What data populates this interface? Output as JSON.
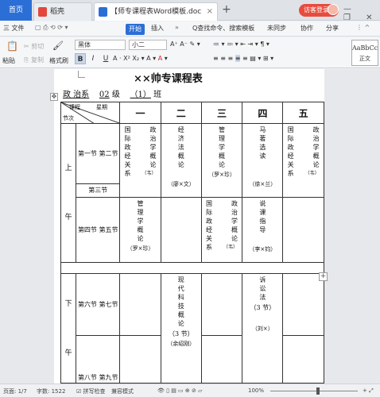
{
  "tabs": {
    "home": "首页",
    "daoke": "稻壳",
    "doc": "【师专课程表Word模板.doc",
    "login": "访客登录"
  },
  "menu": {
    "file": "三 文件",
    "start": "开始",
    "insert": "插入",
    "search": "Q查找命令、搜索模板",
    "unsync": "未同步",
    "collab": "协作",
    "share": "分享"
  },
  "ribbon": {
    "paste": "粘贴",
    "cut": "剪切",
    "copy": "复制",
    "format_painter": "格式刷",
    "font": "黑体",
    "size": "小二",
    "bold": "B",
    "italic": "I",
    "underline": "U",
    "style_sample": "AaBbCc",
    "style_name": "正文"
  },
  "doc": {
    "title": "××帅专课程表",
    "dept": "政 治系",
    "grade": "02",
    "grade_suffix": "级",
    "class": "（1）",
    "class_suffix": "班",
    "header_course": "课程",
    "header_week": "星期",
    "header_period": "节次",
    "days": [
      "一",
      "二",
      "三",
      "四",
      "五"
    ],
    "morning": [
      "上",
      "午"
    ],
    "afternoon": [
      "下",
      "午"
    ],
    "slots": {
      "s12": "第一节 第二节",
      "s3": "第三节",
      "s45": "第四节 第五节",
      "s67": "第六节 第七节",
      "s89": "第八节 第九节"
    },
    "cells": {
      "mon_am1": [
        "国",
        "政",
        "际",
        "治",
        "政",
        "学",
        "经",
        "概",
        "关",
        "论",
        "系",
        "（韦）"
      ],
      "tue_am1": [
        "经",
        "济",
        "法",
        "概",
        "论"
      ],
      "tue_am1_teacher": "（廖×文）",
      "wed_am1": [
        "管",
        "理",
        "学",
        "概",
        "论"
      ],
      "wed_am1_teacher": "（罗×珍）",
      "thu_am1": [
        "马",
        "著",
        "选",
        "读"
      ],
      "thu_am1_teacher": "（徐×兰）",
      "fri_am1": [
        "国",
        "政",
        "际",
        "治",
        "政",
        "学",
        "经",
        "概",
        "关",
        "论",
        "系",
        "（韦）"
      ],
      "tue_am2": [
        "管",
        "理",
        "学",
        "概",
        "论"
      ],
      "tue_am2_teacher": "（罗×珍）",
      "wed_am2": [
        "国",
        "政",
        "际",
        "治",
        "政",
        "学",
        "经",
        "概",
        "关",
        "论",
        "系",
        "（韦）"
      ],
      "thu_am2": [
        "说",
        "课",
        "指",
        "导"
      ],
      "thu_am2_teacher": "（李×钧）",
      "tue_pm": [
        "现",
        "代",
        "科",
        "技",
        "概",
        "论"
      ],
      "tue_pm_hours": "（3 节）",
      "tue_pm_teacher": "（余绍刚）",
      "thu_pm": [
        "诉",
        "讼",
        "法"
      ],
      "thu_pm_hours": "（3 节）",
      "thu_pm_teacher": "（刘×）"
    }
  },
  "status": {
    "page": "页面: 1/7",
    "words": "字数: 1522",
    "spell": "拼写检查",
    "compat": "兼容模式",
    "zoom": "100%"
  }
}
